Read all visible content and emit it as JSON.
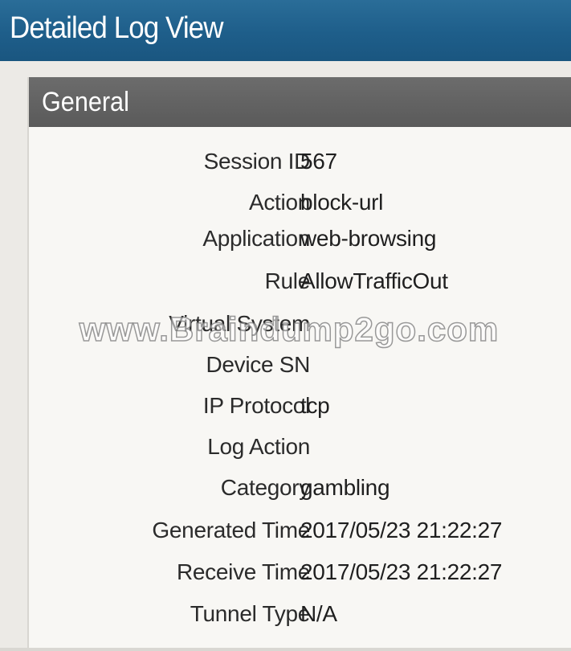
{
  "window": {
    "title": "Detailed Log View"
  },
  "section": {
    "title": "General"
  },
  "fields": [
    {
      "label": "Session ID",
      "value": "567"
    },
    {
      "label": "Action",
      "value": "block-url"
    },
    {
      "label": "Application",
      "value": "web-browsing"
    },
    {
      "label": "Rule",
      "value": "AllowTrafficOut"
    },
    {
      "label": "Virtual System",
      "value": ""
    },
    {
      "label": "Device SN",
      "value": ""
    },
    {
      "label": "IP Protocol",
      "value": "tcp"
    },
    {
      "label": "Log Action",
      "value": ""
    },
    {
      "label": "Category",
      "value": "gambling"
    },
    {
      "label": "Generated Time",
      "value": "2017/05/23 21:22:27"
    },
    {
      "label": "Receive Time",
      "value": "2017/05/23 21:22:27"
    },
    {
      "label": "Tunnel Type",
      "value": "N/A"
    }
  ],
  "watermark": "www.Braindump2go.com",
  "colors": {
    "title_bar": "#1e5e8a",
    "section_header": "#5f5f5f",
    "panel_background": "#f8f7f4"
  }
}
